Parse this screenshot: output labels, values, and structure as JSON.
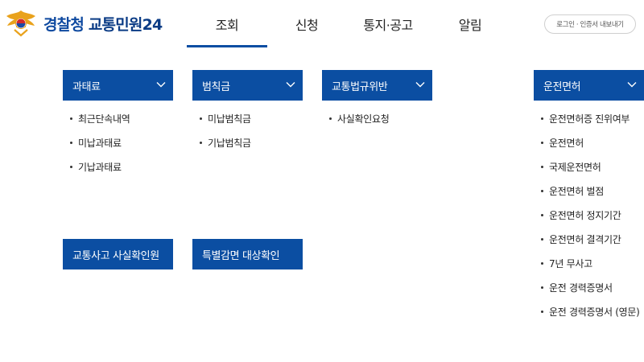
{
  "brand": {
    "name_prefix": "경찰청",
    "name_suffix": "교통민원24",
    "colors": {
      "primary": "#0b4ea2",
      "logo_text": "#0f4aa0",
      "white": "#ffffff"
    }
  },
  "gnb": [
    {
      "label": "조회",
      "active": true
    },
    {
      "label": "신청",
      "active": false
    },
    {
      "label": "통지·공고",
      "active": false
    },
    {
      "label": "알림",
      "active": false
    }
  ],
  "util": {
    "login_label": "로그인 · 인증서 내보내기"
  },
  "icons": {
    "chevron": "chevron-down-icon",
    "bullet": "bullet-dot-icon",
    "emblem": "police-emblem-icon"
  },
  "menu": {
    "fines": {
      "title": "과태료",
      "items": [
        "최근단속내역",
        "미납과태료",
        "기납과태료"
      ]
    },
    "penalty": {
      "title": "범칙금",
      "items": [
        "미납범칙금",
        "기납범칙금"
      ]
    },
    "violation": {
      "title": "교통법규위반",
      "items": [
        "사실확인요청"
      ]
    },
    "license": {
      "title": "운전면허",
      "items": [
        "운전면허증 진위여부",
        "운전면허",
        "국제운전면허",
        "운전면허 벌점",
        "운전면허 정지기간",
        "운전면허 결격기간",
        "7년 무사고",
        "운전 경력증명서",
        "운전 경력증명서 (영문)"
      ]
    },
    "accident": {
      "title": "교통사고 사실확인원"
    },
    "special": {
      "title": "특별감면 대상확인"
    }
  }
}
